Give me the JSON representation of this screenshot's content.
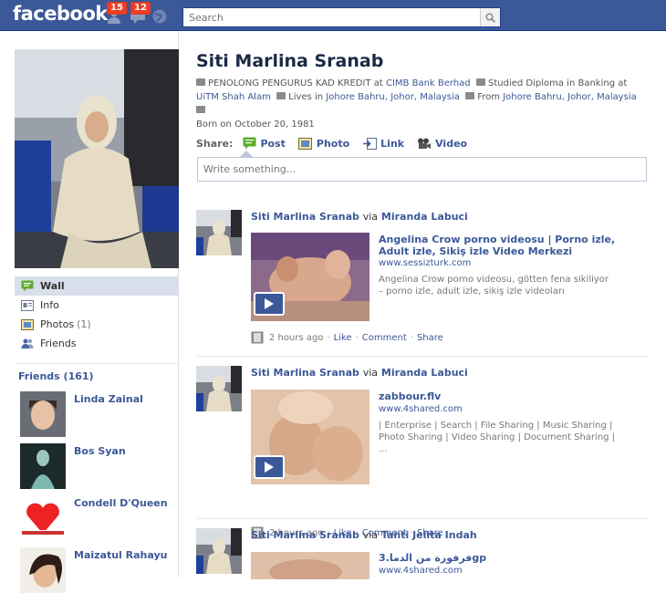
{
  "topbar": {
    "logo": "facebook",
    "friend_requests_count": "15",
    "messages_count": "12",
    "search_placeholder": "Search"
  },
  "profile": {
    "name": "Siti Marlina Sranab",
    "job_prefix": "PENOLONG PENGURUS KAD KREDIT at",
    "job_company": "CIMB Bank Berhad",
    "edu_prefix": "Studied Diploma in Banking at",
    "edu_school": "UiTM Shah Alam",
    "lives_prefix": "Lives in",
    "lives_place": "Johore Bahru, Johor, Malaysia",
    "from_prefix": "From",
    "from_place": "Johore Bahru, Johor, Malaysia",
    "born": "Born on October 20, 1981"
  },
  "left_nav": [
    {
      "label": "Wall",
      "count": ""
    },
    {
      "label": "Info",
      "count": ""
    },
    {
      "label": "Photos",
      "count": "(1)"
    },
    {
      "label": "Friends",
      "count": ""
    }
  ],
  "friends": {
    "header": "Friends (161)",
    "items": [
      "Linda Zainal",
      "Bos Syan",
      "Condell D'Queen",
      "Maizatul Rahayu"
    ]
  },
  "share": {
    "label": "Share:",
    "post": "Post",
    "photo": "Photo",
    "link": "Link",
    "video": "Video",
    "composer_placeholder": "Write something..."
  },
  "stories": [
    {
      "actor": "Siti Marlina Sranab",
      "via_word": "via",
      "via": "Miranda Labuci",
      "title": "Angelina Crow porno videosu | Porno izle, Adult izle, Sikiş izle Video Merkezi",
      "url": "www.sessizturk.com",
      "desc": "Angelina Crow porno videosu, götten fena sikiliyor – porno izle, adult izle, sikiş izle videoları",
      "time": "2 hours ago",
      "like": "Like",
      "comment": "Comment",
      "share": "Share"
    },
    {
      "actor": "Siti Marlina Sranab",
      "via_word": "via",
      "via": "Miranda Labuci",
      "title": "zabbour.flv",
      "url": "www.4shared.com",
      "desc": "| Enterprise | Search | File Sharing | Music Sharing | Photo Sharing | Video Sharing | Document Sharing | ...",
      "time": "2 hours ago",
      "like": "Like",
      "comment": "Comment",
      "share": "Share"
    },
    {
      "actor": "Siti Marlina Sranab",
      "via_word": "via",
      "via": "Tanti Jelita Indah",
      "title": "3.فرفورة من الدماgp",
      "url": "www.4shared.com"
    }
  ],
  "colors": {
    "brand": "#3b5998",
    "badge": "#f03d25",
    "nav_active": "#d8dfea"
  }
}
